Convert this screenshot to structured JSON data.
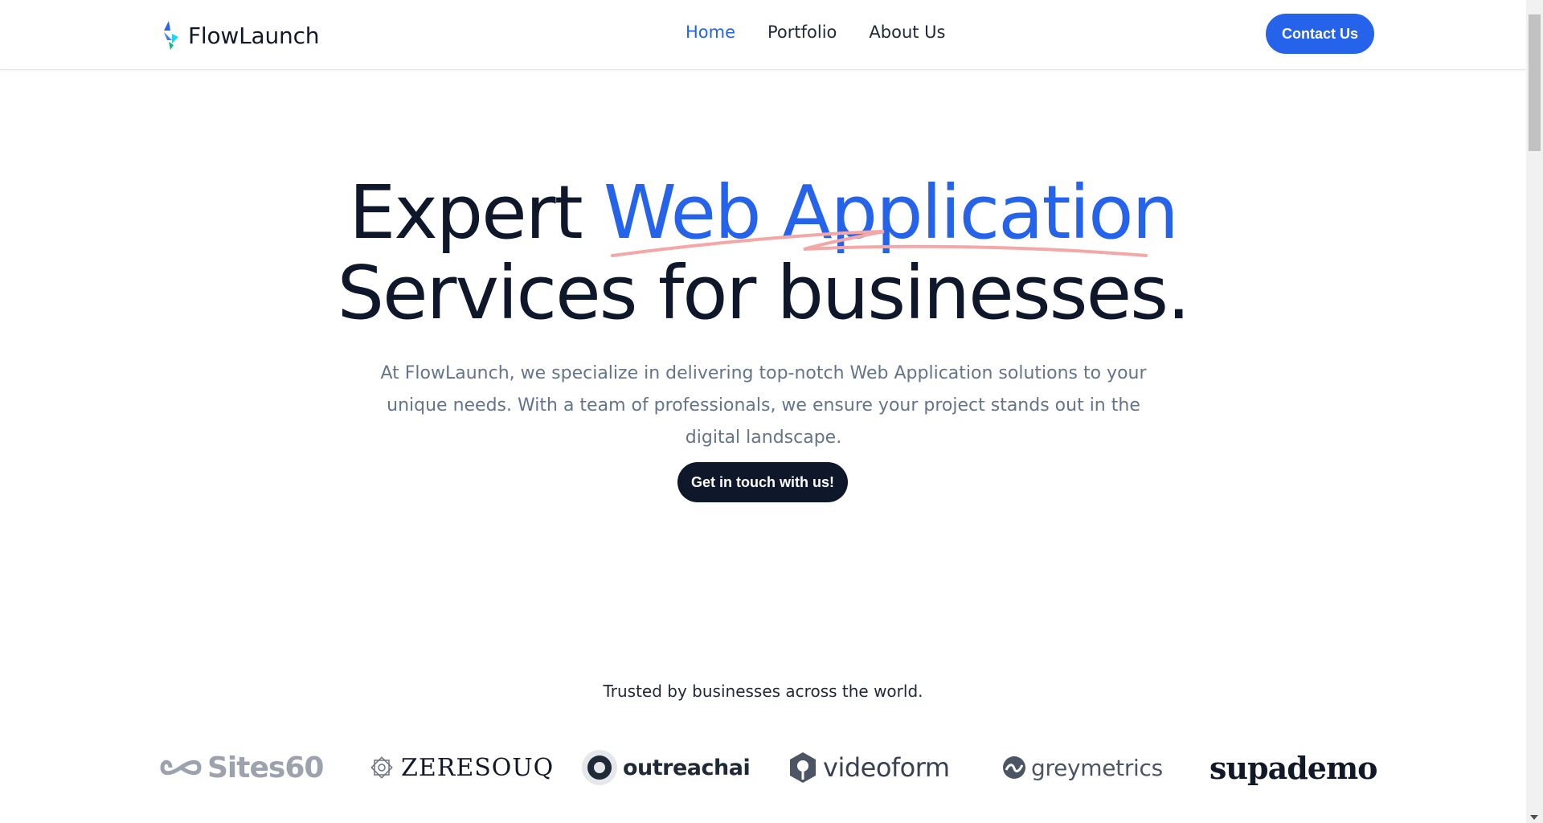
{
  "header": {
    "brand": "FlowLaunch",
    "nav": [
      {
        "label": "Home",
        "active": true
      },
      {
        "label": "Portfolio",
        "active": false
      },
      {
        "label": "About Us",
        "active": false
      }
    ],
    "contact_label": "Contact Us"
  },
  "hero": {
    "title_line1_plain": "Expert ",
    "title_line1_accent": "Web Application",
    "title_line2": "Services for businesses.",
    "subtitle": "At FlowLaunch, we specialize in delivering top-notch Web Application solutions to your unique needs. With a team of professionals, we ensure your project stands out in the digital landscape.",
    "cta_label": "Get in touch with us!"
  },
  "trusted": {
    "heading": "Trusted by businesses across the world.",
    "logos": [
      "Sites60",
      "ZERESOUQ",
      "outreachai",
      "videoform",
      "greymetrics",
      "supademo"
    ]
  },
  "colors": {
    "accent": "#2563eb",
    "dark": "#0f172a",
    "muted": "#64748b",
    "underline": "#f4a7a7"
  }
}
